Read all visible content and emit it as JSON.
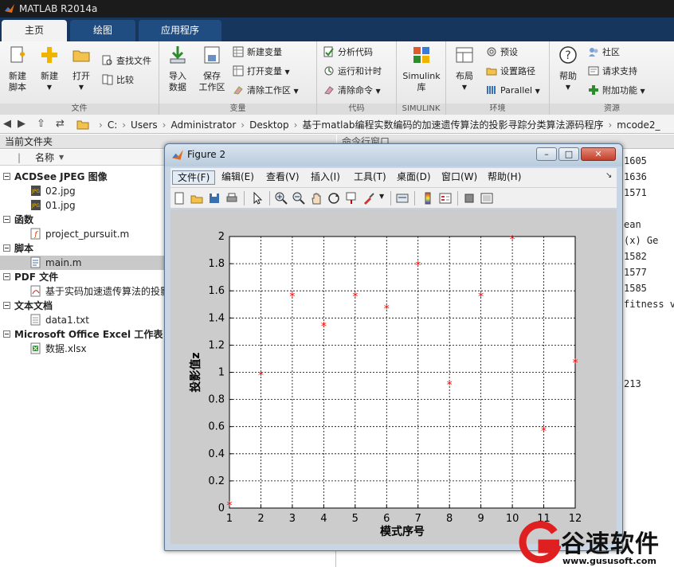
{
  "app": {
    "title": "MATLAB R2014a"
  },
  "tabs": [
    {
      "label": "主页"
    },
    {
      "label": "绘图"
    },
    {
      "label": "应用程序"
    }
  ],
  "ribbon": {
    "file": {
      "label": "文件",
      "new_script": "新建\n脚本",
      "new": "新建",
      "open": "打开",
      "find_files": "查找文件",
      "compare": "比较"
    },
    "variable": {
      "label": "变量",
      "import_data": "导入\n数据",
      "save_workspace": "保存\n工作区",
      "new_variable": "新建变量",
      "open_variable": "打开变量",
      "clear_workspace": "清除工作区"
    },
    "code": {
      "label": "代码",
      "analyze_code": "分析代码",
      "run_and_time": "运行和计时",
      "clear_commands": "清除命令"
    },
    "simulink": {
      "label": "SIMULINK",
      "library": "Simulink\n库"
    },
    "environment": {
      "label": "环境",
      "layout": "布局",
      "preferences": "预设",
      "set_path": "设置路径",
      "parallel": "Parallel"
    },
    "resources": {
      "label": "资源",
      "help": "帮助",
      "community": "社区",
      "request_support": "请求支持",
      "add_ons": "附加功能"
    }
  },
  "address": {
    "segments": [
      "C:",
      "Users",
      "Administrator",
      "Desktop",
      "基于matlab编程实数编码的加速遗传算法的投影寻踪分类算法源码程序",
      "mcode2_"
    ]
  },
  "current_folder": {
    "title": "当前文件夹",
    "column_name": "名称",
    "sections": [
      {
        "label": "ACDSee JPEG 图像",
        "files": [
          "02.jpg",
          "01.jpg"
        ]
      },
      {
        "label": "函数",
        "files": [
          "project_pursuit.m"
        ]
      },
      {
        "label": "脚本",
        "files": [
          "main.m"
        ]
      },
      {
        "label": "PDF 文件",
        "files": [
          "基于实码加速遗传算法的投影"
        ]
      },
      {
        "label": "文本文档",
        "files": [
          "data1.txt"
        ]
      },
      {
        "label": "Microsoft Office Excel 工作表",
        "files": [
          "数据.xlsx"
        ]
      }
    ]
  },
  "command_window": {
    "title": "命令行窗口",
    "lines": [
      "1605",
      "1636",
      "1571",
      "ean",
      "(x)    Ge",
      "1582",
      "1577",
      "1585",
      "fitness v",
      "213"
    ]
  },
  "figure": {
    "title": "Figure 2",
    "menu": [
      "文件(F)",
      "编辑(E)",
      "查看(V)",
      "插入(I)",
      "工具(T)",
      "桌面(D)",
      "窗口(W)",
      "帮助(H)"
    ]
  },
  "chart_data": {
    "type": "scatter",
    "xlabel": "模式序号",
    "ylabel": "投影值z",
    "xlim": [
      1,
      12
    ],
    "ylim": [
      0,
      2
    ],
    "xticks": [
      1,
      2,
      3,
      4,
      5,
      6,
      7,
      8,
      9,
      10,
      11,
      12
    ],
    "yticks": [
      0,
      0.2,
      0.4,
      0.6,
      0.8,
      1,
      1.2,
      1.4,
      1.6,
      1.8,
      2
    ],
    "grid": true,
    "marker": "*",
    "marker_color": "#ff0000",
    "x": [
      1,
      2,
      3,
      4,
      5,
      6,
      7,
      8,
      9,
      10,
      11,
      12
    ],
    "y": [
      0.02,
      0.98,
      1.56,
      1.34,
      1.56,
      1.47,
      1.79,
      0.91,
      1.56,
      1.98,
      0.57,
      1.07
    ]
  },
  "watermark": {
    "title": "谷速软件",
    "url": "www.gususoft.com"
  }
}
